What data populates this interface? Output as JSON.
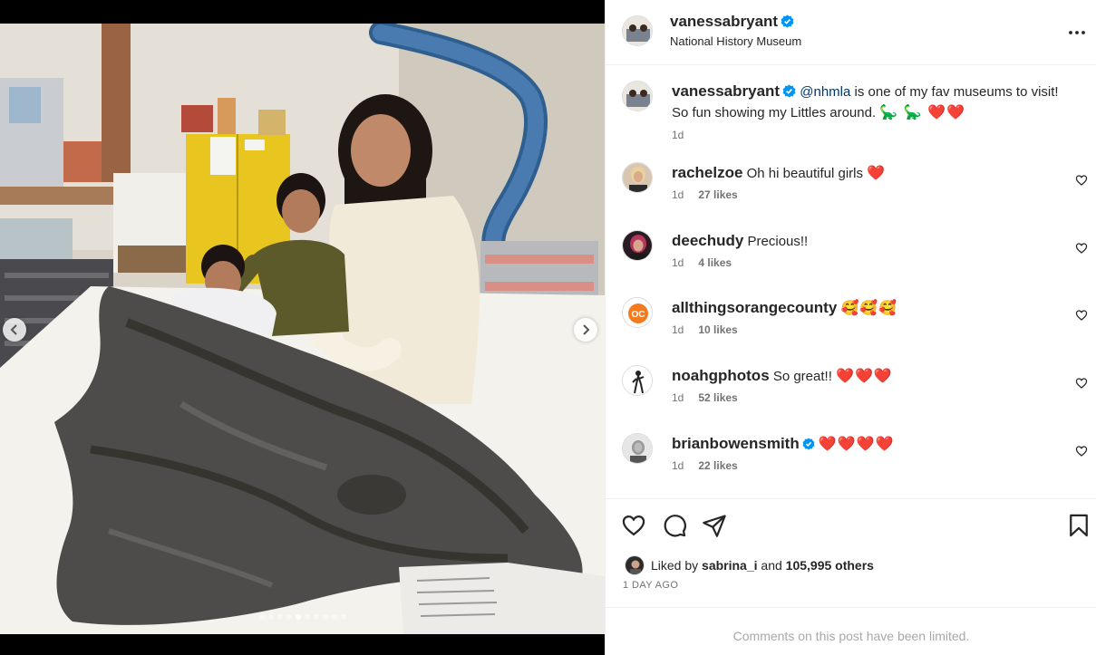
{
  "post": {
    "author": "vanessabryant",
    "location": "National History Museum"
  },
  "caption": {
    "username": "vanessabryant",
    "mention": "@nhmla",
    "text_line1": " is one of my fav museums to visit!",
    "text_line2": "So fun showing my Littles around. ",
    "emoji": "🦕 🦕 ❤️❤️",
    "time": "1d"
  },
  "comments": [
    {
      "username": "rachelzoe",
      "text": "Oh hi beautiful girls",
      "emoji": "❤️",
      "time": "1d",
      "likes": "27 likes"
    },
    {
      "username": "deechudy",
      "text": "Precious!!",
      "emoji": "",
      "time": "1d",
      "likes": "4 likes"
    },
    {
      "username": "allthingsorangecounty",
      "text": "",
      "emoji": "🥰🥰🥰",
      "time": "1d",
      "likes": "10 likes"
    },
    {
      "username": "noahgphotos",
      "text": "So great!!",
      "emoji": "❤️❤️❤️",
      "time": "1d",
      "likes": "52 likes"
    },
    {
      "username": "brianbowensmith",
      "text": "",
      "emoji": "❤️❤️❤️❤️",
      "time": "1d",
      "likes": "22 likes"
    }
  ],
  "likes": {
    "prefix": "Liked by ",
    "user": "sabrina_i",
    "middle": " and ",
    "others": "105,995 others"
  },
  "post_time": "1 DAY AGO",
  "comments_limited": "Comments on this post have been limited.",
  "carousel": {
    "count": 10,
    "active_index": 4
  },
  "colors": {
    "accent_blue": "#0095f6",
    "heart_red": "#e0142a",
    "muted": "#737373"
  }
}
